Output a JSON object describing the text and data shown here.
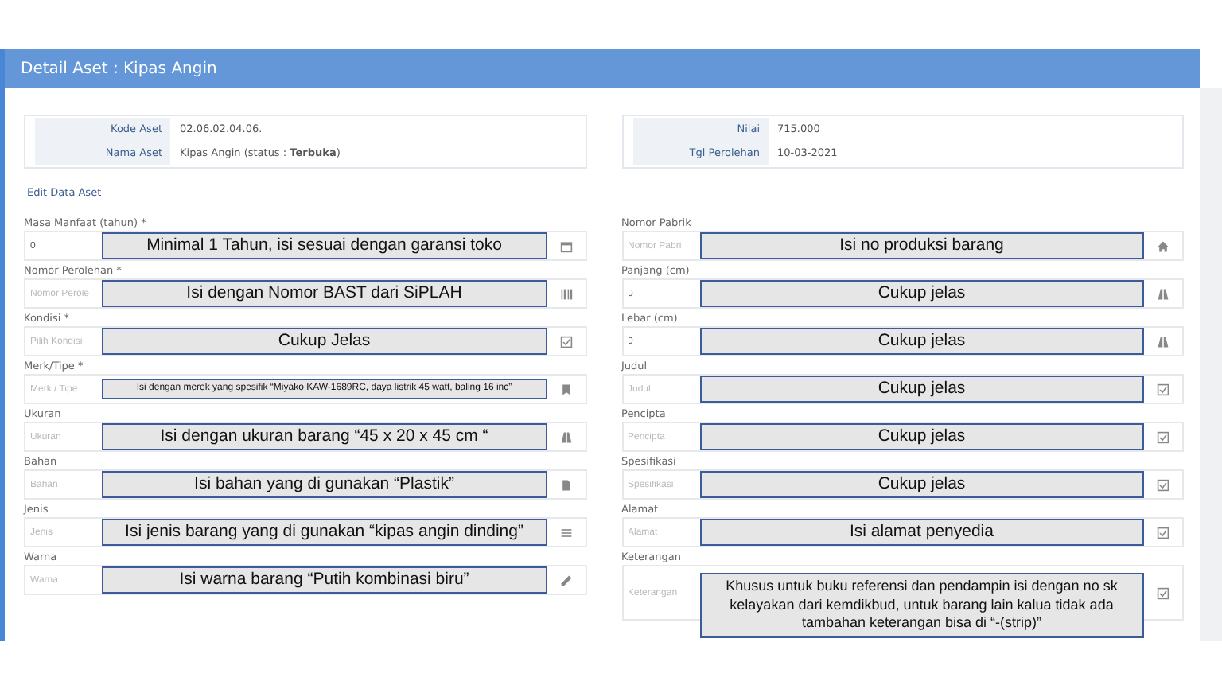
{
  "window": {
    "title": "Detail Aset : Kipas Angin"
  },
  "info_left": [
    {
      "label": "Kode Aset",
      "value": "02.06.02.04.06."
    },
    {
      "label": "Nama Aset",
      "value": "Kipas Angin (status : **Terbuka**)"
    }
  ],
  "info_right": [
    {
      "label": "Nilai",
      "value": "715.000"
    },
    {
      "label": "Tgl Perolehan",
      "value": "10-03-2021"
    }
  ],
  "edit_link": "Edit Data Aset",
  "fields_left": [
    {
      "kind": "normal",
      "label": "Masa Manfaat (tahun) *",
      "value": "0",
      "note": "Minimal 1 Tahun, isi sesuai dengan garansi toko"
    },
    {
      "kind": "normal",
      "label": "Nomor Perolehan *",
      "placeholder": "Nomor Perole",
      "note": "Isi dengan Nomor BAST dari SiPLAH"
    },
    {
      "kind": "normal",
      "label": "Kondisi *",
      "placeholder": "Pilih Kondisi",
      "note": "Cukup Jelas"
    },
    {
      "kind": "fine_print",
      "label": "Merk/Tipe *",
      "placeholder": "Merk / Tipe",
      "note": "Isi dengan merek yang spesifik “Miyako KAW-1689RC, daya listrik 45 watt, baling 16 inc”"
    },
    {
      "kind": "normal",
      "label": "Ukuran",
      "placeholder": "Ukuran",
      "note": "Isi dengan ukuran barang  “45 x 20 x 45 cm “"
    },
    {
      "kind": "normal",
      "label": "Bahan",
      "placeholder": "Bahan",
      "note": "Isi bahan yang di gunakan “Plastik”"
    },
    {
      "kind": "normal",
      "label": "Jenis",
      "placeholder": "Jenis",
      "note": "Isi jenis barang yang di gunakan “kipas angin dinding”"
    },
    {
      "kind": "normal",
      "label": "Warna",
      "placeholder": "Warna",
      "note": "Isi warna barang “Putih kombinasi biru”"
    }
  ],
  "fields_right": [
    {
      "kind": "normal",
      "label": "Nomor Pabrik",
      "placeholder": "Nomor Pabri",
      "note": "Isi no produksi barang"
    },
    {
      "kind": "normal",
      "label": "Panjang (cm)",
      "value": "0",
      "note": "Cukup jelas"
    },
    {
      "kind": "normal",
      "label": "Lebar (cm)",
      "value": "0",
      "note": "Cukup jelas"
    },
    {
      "kind": "normal",
      "label": "Judul",
      "placeholder": "Judul",
      "note": "Cukup jelas"
    },
    {
      "kind": "normal",
      "label": "Pencipta",
      "placeholder": "Pencipta",
      "note": "Cukup jelas"
    },
    {
      "kind": "normal",
      "label": "Spesifikasi",
      "placeholder": "Spesifikasi",
      "note": "Cukup jelas"
    },
    {
      "kind": "normal",
      "label": "Alamat",
      "placeholder": "Alamat",
      "note": "Isi alamat penyedia"
    },
    {
      "kind": "paragraph",
      "label": "Keterangan",
      "placeholder": "Keterangan",
      "note": "Khusus untuk buku referensi dan pendampin isi dengan no sk kelayakan dari kemdikbud, untuk barang lain kalua tidak ada tambahan keterangan bisa di “-(strip)”"
    }
  ]
}
